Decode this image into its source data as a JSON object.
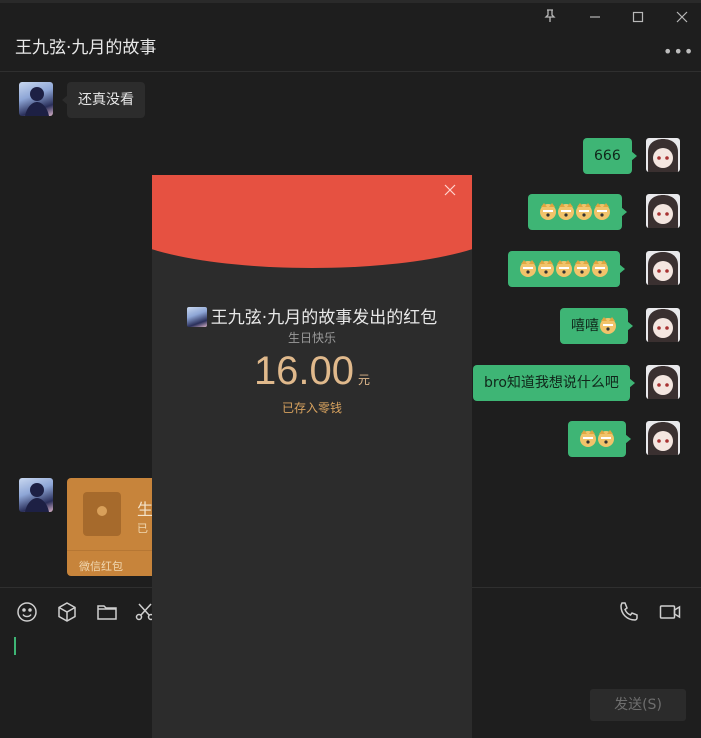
{
  "window": {
    "title": "王九弦·九月的故事",
    "more": "•••"
  },
  "controls": {
    "pin": "⊥",
    "minimize": "—",
    "maximize": "☐",
    "close": "✕"
  },
  "messages": {
    "m1": "还真没看",
    "m2": "666",
    "m5": "嘻嘻",
    "m6": "bro知道我想说什么吧"
  },
  "redpack_message": {
    "title_partial": "生",
    "subtitle_partial": "已",
    "label": "微信红包"
  },
  "popup": {
    "sender_text": "王九弦·九月的故事发出的红包",
    "wish": "生日快乐",
    "amount": "16.00",
    "unit": "元",
    "status": "已存入零钱",
    "close": "×"
  },
  "input": {
    "send_label": "发送(S)"
  }
}
